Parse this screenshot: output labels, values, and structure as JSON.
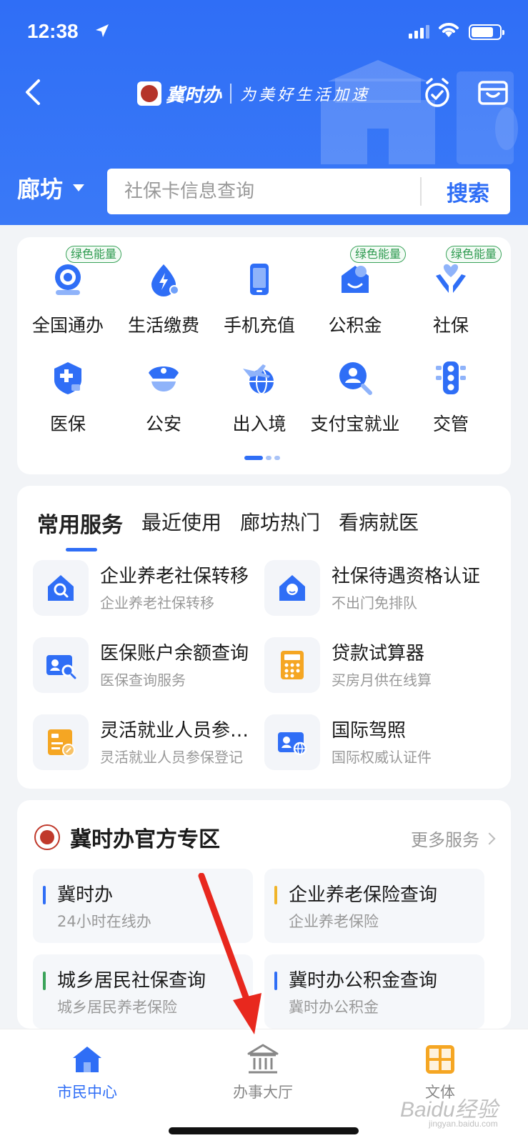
{
  "status_bar": {
    "time": "12:38"
  },
  "header": {
    "app_name": "冀时办",
    "slogan": "为美好生活加速",
    "city": "廊坊",
    "search": {
      "placeholder": "社保卡信息查询",
      "button": "搜索"
    }
  },
  "quick_grid": {
    "items": [
      {
        "label": "全国通办",
        "icon": "globe-service-icon",
        "tag": "绿色能量"
      },
      {
        "label": "生活缴费",
        "icon": "water-bill-icon"
      },
      {
        "label": "手机充值",
        "icon": "phone-icon"
      },
      {
        "label": "公积金",
        "icon": "housing-fund-icon",
        "tag": "绿色能量"
      },
      {
        "label": "社保",
        "icon": "social-security-icon",
        "tag": "绿色能量"
      },
      {
        "label": "医保",
        "icon": "medical-insurance-icon"
      },
      {
        "label": "公安",
        "icon": "police-cap-icon"
      },
      {
        "label": "出入境",
        "icon": "plane-globe-icon"
      },
      {
        "label": "支付宝就业",
        "icon": "job-search-icon"
      },
      {
        "label": "交管",
        "icon": "traffic-light-icon"
      }
    ],
    "page_count": 3,
    "active_page": 1
  },
  "services": {
    "tabs": [
      "常用服务",
      "最近使用",
      "廊坊热门",
      "看病就医"
    ],
    "active_tab": "常用服务",
    "items": [
      {
        "title": "企业养老社保转移",
        "subtitle": "企业养老社保转移",
        "icon": "house-search-icon"
      },
      {
        "title": "社保待遇资格认证",
        "subtitle": "不出门免排队",
        "icon": "house-face-icon"
      },
      {
        "title": "医保账户余额查询",
        "subtitle": "医保查询服务",
        "icon": "id-search-icon"
      },
      {
        "title": "贷款试算器",
        "subtitle": "买房月供在线算",
        "icon": "calculator-icon"
      },
      {
        "title": "灵活就业人员参保登记",
        "subtitle": "灵活就业人员参保登记",
        "icon": "insurance-form-icon"
      },
      {
        "title": "国际驾照",
        "subtitle": "国际权威认证件",
        "icon": "id-globe-icon"
      }
    ]
  },
  "official": {
    "title": "冀时办官方专区",
    "more": "更多服务",
    "items": [
      {
        "title": "冀时办",
        "subtitle": "24小时在线办",
        "bar_color": "#2f6ef6"
      },
      {
        "title": "企业养老保险查询",
        "subtitle": "企业养老保险",
        "bar_color": "#f0b429"
      },
      {
        "title": "城乡居民社保查询",
        "subtitle": "城乡居民养老保险",
        "bar_color": "#3aa35a"
      },
      {
        "title": "冀时办公积金查询",
        "subtitle": "冀时办公积金",
        "bar_color": "#2f6ef6"
      }
    ]
  },
  "tabbar": {
    "items": [
      {
        "label": "市民中心",
        "icon": "home-icon",
        "active": true
      },
      {
        "label": "办事大厅",
        "icon": "government-hall-icon",
        "active": false
      },
      {
        "label": "文体",
        "icon": "culture-sports-icon",
        "active": false
      }
    ]
  },
  "watermark": {
    "text": "Baidu经验",
    "sub": "jingyan.baidu.com"
  },
  "colors": {
    "primary": "#2f6ef6",
    "green_tag": "#2d9a4f",
    "orange_icon": "#f5a623",
    "annotation_red": "#e8281e"
  }
}
